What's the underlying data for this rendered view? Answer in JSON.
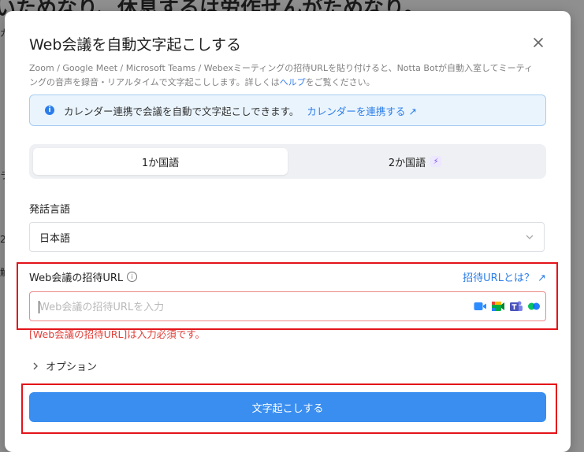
{
  "background": {
    "heading": "いためなり、休息するは労作せんがためなり。",
    "fragments": [
      "ガ",
      "ラ",
      "2",
      "解"
    ]
  },
  "modal": {
    "title": "Web会議を自動文字起こしする",
    "description_prefix": "Zoom / Google Meet / Microsoft Teams / Webexミーティングの招待URLを貼り付けると、Notta Botが自動入室してミーティングの音声を録音・リアルタイムで文字起こしします。詳しくは",
    "description_link": "ヘルプ",
    "description_suffix": "をご覧ください。",
    "info_banner": {
      "text": "カレンダー連携で会議を自動で文字起こしできます。",
      "link": "カレンダーを連携する ↗"
    },
    "language_mode": {
      "options": [
        "1か国語",
        "2か国語"
      ],
      "selected": "1か国語"
    },
    "spoken_language": {
      "label": "発話言語",
      "value": "日本語"
    },
    "meeting_url": {
      "label": "Web会議の招待URL",
      "help_link": "招待URLとは？ ↗",
      "placeholder": "Web会議の招待URLを入力",
      "value": "",
      "error": "[Web会議の招待URL]は入力必須です。",
      "service_icons": [
        "zoom-icon",
        "google-meet-icon",
        "teams-icon",
        "webex-icon"
      ]
    },
    "options_label": "オプション",
    "submit_label": "文字起こしする"
  },
  "colors": {
    "accent": "#3a8ef0",
    "error": "#e0403a",
    "highlight": "#e3141a"
  }
}
